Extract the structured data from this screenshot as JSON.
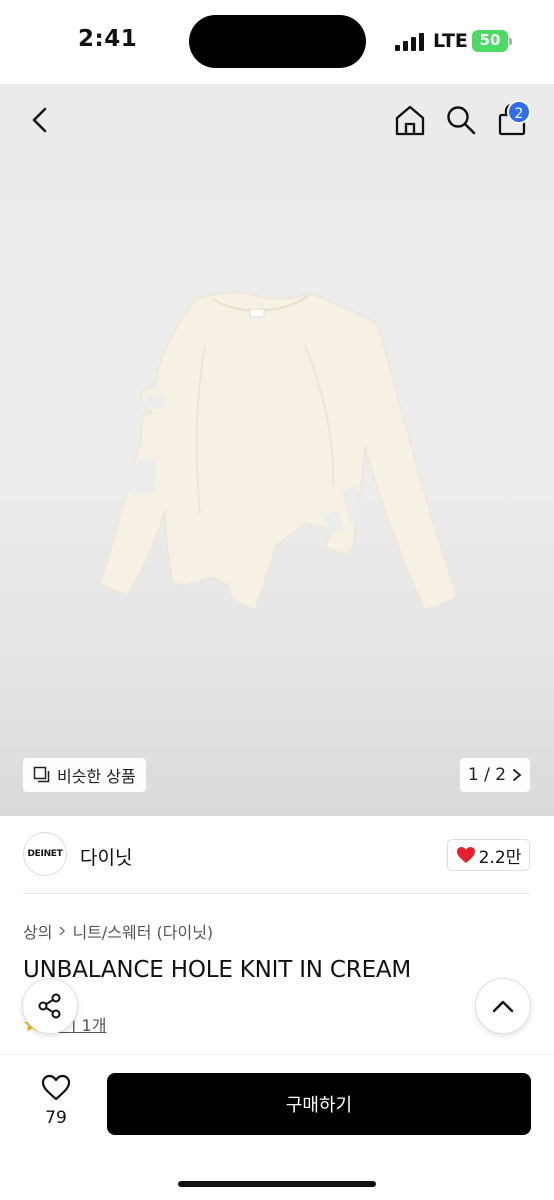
{
  "status_bar": {
    "time": "2:41",
    "network": "LTE",
    "battery": "50"
  },
  "nav": {
    "cart_count": "2",
    "icons": [
      "chevron-left-icon",
      "home-icon",
      "search-icon",
      "shopping-bag-icon"
    ]
  },
  "gallery": {
    "similar_label": "비슷한 상품",
    "pager": "1 / 2"
  },
  "brand": {
    "logo_text": "DEINET",
    "name": "다이닛",
    "likes": "2.2만"
  },
  "product": {
    "breadcrumb": [
      "상의",
      "니트/스웨터 (다이닛)"
    ],
    "title": "UNBALANCE HOLE KNIT IN CREAM",
    "review_label": "후기 1개"
  },
  "bottom_bar": {
    "wish_count": "79",
    "buy_label": "구매하기"
  },
  "colors": {
    "accent_badge": "#2d6cf5",
    "heart": "#e8202a",
    "buy_button": "#000000",
    "battery": "#4cd964"
  }
}
